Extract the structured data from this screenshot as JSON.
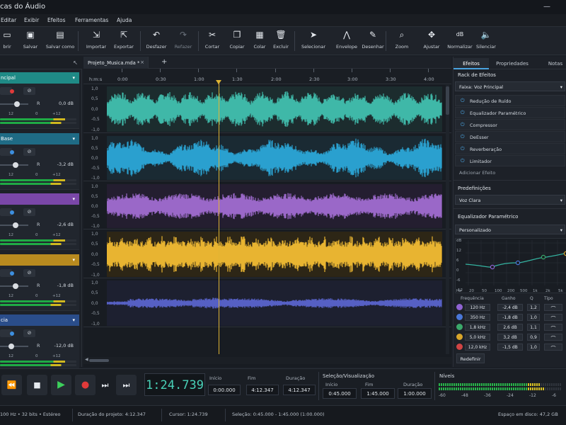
{
  "window": {
    "title": "cas do Áudio"
  },
  "menu": [
    "Editar",
    "Exibir",
    "Efeitos",
    "Ferramentas",
    "Ajuda"
  ],
  "toolbar": {
    "items": [
      {
        "label": "brir",
        "icon": "folder-open-icon",
        "glyph": "▭"
      },
      {
        "label": "Salvar",
        "icon": "save-icon",
        "glyph": "▣"
      },
      {
        "label": "Salvar como",
        "icon": "save-as-icon",
        "glyph": "▤"
      },
      {
        "label": "Importar",
        "icon": "import-icon",
        "glyph": "⇲"
      },
      {
        "label": "Exportar",
        "icon": "export-icon",
        "glyph": "⇱"
      },
      {
        "label": "Desfazer",
        "icon": "undo-icon",
        "glyph": "↶"
      },
      {
        "label": "Refazer",
        "icon": "redo-icon",
        "glyph": "↷"
      },
      {
        "label": "Cortar",
        "icon": "scissors-icon",
        "glyph": "✂"
      },
      {
        "label": "Copiar",
        "icon": "copy-icon",
        "glyph": "❐"
      },
      {
        "label": "Colar",
        "icon": "paste-icon",
        "glyph": "▦"
      },
      {
        "label": "Excluir",
        "icon": "trash-icon",
        "glyph": "🗑"
      },
      {
        "label": "Selecionar",
        "icon": "cursor-icon",
        "glyph": "➤"
      },
      {
        "label": "Envelope",
        "icon": "envelope-icon",
        "glyph": "⋀"
      },
      {
        "label": "Desenhar",
        "icon": "pencil-icon",
        "glyph": "✎"
      },
      {
        "label": "Zoom",
        "icon": "magnifier-icon",
        "glyph": "⌕"
      },
      {
        "label": "Ajustar",
        "icon": "fit-icon",
        "glyph": "✥"
      },
      {
        "label": "Normalizar",
        "icon": "db-icon",
        "glyph": "dB"
      },
      {
        "label": "Silenciar",
        "icon": "mute-icon",
        "glyph": "🔈"
      }
    ]
  },
  "tracks": [
    {
      "name": "ncipal",
      "color": "#1f8a86",
      "value": "0,0 dB",
      "knob_pct": 0.6
    },
    {
      "name": "Base",
      "color": "#1f6b85",
      "value": "-3,2 dB",
      "knob_pct": 0.55
    },
    {
      "name": "",
      "color": "#7a47a8",
      "value": "-2,6 dB",
      "knob_pct": 0.55
    },
    {
      "name": "",
      "color": "#b88a1f",
      "value": "-1,8 dB",
      "knob_pct": 0.55
    },
    {
      "name": "cia",
      "color": "#2a4d8a",
      "value": "-12,0 dB",
      "knob_pct": 0.4
    }
  ],
  "track_common": {
    "r_label": "R",
    "meter_ticks": [
      "12",
      "0",
      "+12"
    ]
  },
  "editor": {
    "tab_label": "Projeto_Musica.mda *",
    "tab_close": "×",
    "add_tab": "+",
    "ruler_unit": "h:m:s",
    "ruler_ticks": [
      "0:00",
      "0:30",
      "1:00",
      "1:30",
      "2:00",
      "2:30",
      "3:00",
      "3:30",
      "4:00"
    ],
    "y_labels": [
      "1,0",
      "0,5",
      "0,0",
      "-0,5",
      "-1,0"
    ],
    "lanes": [
      {
        "color": "#3fb8a8",
        "bg": "#1c2c2e"
      },
      {
        "color": "#2aa0cf",
        "bg": "#1a2a33"
      },
      {
        "color": "#9a68c8",
        "bg": "#241e30"
      },
      {
        "color": "#e8b431",
        "bg": "#2d2616"
      },
      {
        "color": "#5660c4",
        "bg": "#1d2030"
      }
    ],
    "playhead_fraction": 0.31
  },
  "right": {
    "tabs": [
      "Efeitos",
      "Propriedades",
      "Notas"
    ],
    "rack_title": "Rack de Efeitos",
    "track_select": "Faixa: Voz Principal",
    "effects": [
      "Redução de Ruído",
      "Equalizador Paramétrico",
      "Compressor",
      "DeEsser",
      "Reverberação",
      "Limitador"
    ],
    "add_effect": "Adicionar Efeito",
    "presets_title": "Predefinições",
    "preset_value": "Voz Clara",
    "eq_title": "Equalizador Paramétrico",
    "eq_mode": "Personalizado",
    "eq_y": [
      "dB",
      "12",
      "6",
      "0",
      "-6",
      "-12"
    ],
    "eq_x": [
      "Hz",
      "20",
      "50",
      "100",
      "200",
      "500",
      "1k",
      "2k",
      "5k"
    ],
    "eq_headers": [
      "Frequência",
      "Ganho",
      "Q",
      "Tipo"
    ],
    "eq_bands": [
      {
        "freq": "120 Hz",
        "gain": "-2,4 dB",
        "q": "1,2",
        "color": "#8f63d2"
      },
      {
        "freq": "350 Hz",
        "gain": "-1,8 dB",
        "q": "1,0",
        "color": "#4a77d8"
      },
      {
        "freq": "1,8 kHz",
        "gain": "2,6 dB",
        "q": "1,1",
        "color": "#3ba86a"
      },
      {
        "freq": "5,0 kHz",
        "gain": "3,2 dB",
        "q": "0,9",
        "color": "#d8a52a"
      },
      {
        "freq": "12,0 kHz",
        "gain": "-1,5 dB",
        "q": "1,0",
        "color": "#d04444"
      }
    ],
    "reset_label": "Redefinir"
  },
  "transport": {
    "time": "1:24.739",
    "start_label": "Início",
    "start": "0:00.000",
    "end_label": "Fim",
    "end": "4:12.347",
    "dur_label": "Duração",
    "dur": "4:12.347",
    "sel_title": "Seleção/Visualização",
    "sel_start_label": "Início",
    "sel_start": "0:45.000",
    "sel_end_label": "Fim",
    "sel_end": "1:45.000",
    "sel_dur_label": "Duração",
    "sel_dur": "1:00.000",
    "levels_title": "Níveis",
    "level_ticks": [
      "-60",
      "-48",
      "-36",
      "-24",
      "-12",
      "-6"
    ]
  },
  "status": {
    "format": "100 Hz • 32 bits • Estéreo",
    "project_duration": "Duração do projeto: 4:12.347",
    "cursor": "Cursor: 1:24.739",
    "selection": "Seleção: 0:45.000 - 1:45.000 (1:00.000)",
    "disk": "Espaço em disco: 47,2 GB"
  }
}
